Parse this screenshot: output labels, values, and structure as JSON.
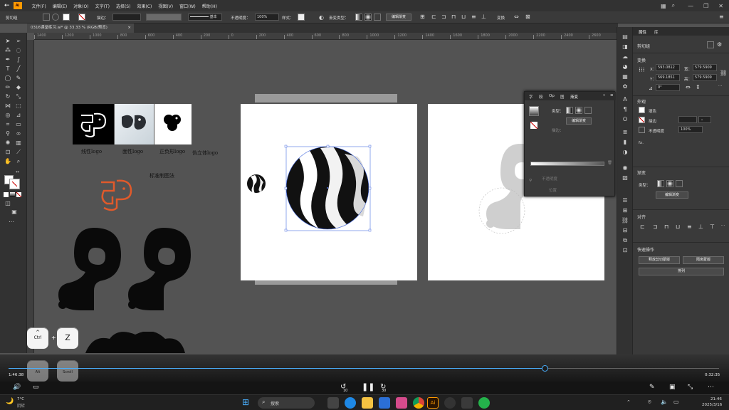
{
  "menu": {
    "items": [
      "文件(F)",
      "编辑(E)",
      "对象(O)",
      "文字(T)",
      "选择(S)",
      "效果(C)",
      "视图(V)",
      "窗口(W)",
      "帮助(H)"
    ]
  },
  "control": {
    "group_label": "剪切组",
    "stroke_label": "描边：",
    "stroke_line_label": "基本",
    "opacity_label": "不透明度：",
    "opacity_value": "100%",
    "style_label": "样式：",
    "gradient_type_label": "渐变类型：",
    "edit_gradient": "编辑渐变",
    "transform_label": "变换",
    "fill_color": "#ffffff",
    "stroke_color": "#cc0000"
  },
  "document": {
    "tab_title": "0316课堂练习.ai* @ 33.33 % (RGB/预览)",
    "ruler_ticks": [
      "1400",
      "1200",
      "1000",
      "800",
      "600",
      "400",
      "200",
      "0",
      "200",
      "400",
      "600",
      "800",
      "1000",
      "1200",
      "1400",
      "1600",
      "1800",
      "2000",
      "2200",
      "2400",
      "2600"
    ]
  },
  "canvas": {
    "captions": {
      "linear": "线性logo",
      "face": "面性logo",
      "neg": "正负形logo",
      "pseudo3d": "伪立体logo",
      "std": "标准制图法"
    },
    "accent_color": "#e05a2b"
  },
  "gradient_panel": {
    "tabs": [
      "字",
      "段",
      "Op",
      "图",
      "渐变"
    ],
    "type_label": "类型：",
    "edit_button": "编辑渐变",
    "stroke_label": "描边：",
    "opacity_label": "不透明度",
    "position_label": "位置"
  },
  "properties": {
    "tabs": [
      "属性",
      "库"
    ],
    "object_type": "剪切组",
    "transform_title": "变换",
    "x_label": "X：",
    "x_value": "593.0812",
    "y_label": "Y：",
    "y_value": "569.1851",
    "w_label": "宽：",
    "w_value": "579.5909",
    "h_label": "高：",
    "h_value": "579.5909",
    "angle_value": "0°",
    "appearance_title": "外观",
    "fill_label": "填色",
    "stroke_label": "描边",
    "opacity_label": "不透明度",
    "opacity_value": "100%",
    "fx_label": "fx.",
    "gradient_title": "渐变",
    "gradient_type_label": "类型：",
    "edit_gradient_button": "编辑渐变",
    "align_title": "对齐",
    "quick_actions_title": "快速操作",
    "release_mask_button": "释放剪切蒙版",
    "isolate_button": "隔离蒙版",
    "arrange_button": "排列"
  },
  "video": {
    "current_time": "1:46:38",
    "total_time": "0:32:35",
    "progress": 0.755,
    "keys": {
      "ctrl": "Ctrl",
      "z": "Z",
      "alt": "Alt",
      "scroll": "Scroll",
      "plus": "+"
    },
    "skip_back": "10",
    "skip_fwd": "30"
  },
  "taskbar": {
    "weather_temp": "7°C",
    "weather_desc": "阴转",
    "search_placeholder": "搜索",
    "time": "21:46",
    "date": "2025/3/16"
  }
}
